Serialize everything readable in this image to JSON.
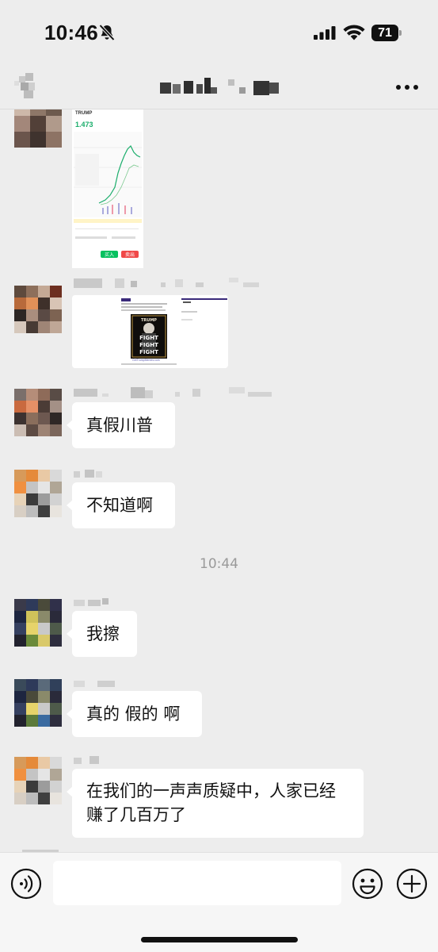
{
  "status_bar": {
    "time": "10:46",
    "battery": "71",
    "icons": [
      "bell-slash-icon",
      "cellular-signal-icon",
      "wifi-icon",
      "battery-icon"
    ]
  },
  "nav": {
    "back_icon": "back-icon",
    "title_icon": "pixelated-chat-title",
    "more_icon": "more-icon"
  },
  "messages": [
    {
      "type": "image",
      "thumb": {
        "token": "TRUMP",
        "price": "1.473",
        "buy": "买入",
        "sell": "卖出"
      }
    },
    {
      "type": "image",
      "thumb": {
        "poster": [
          "TRUMP",
          "FIGHT",
          "FIGHT",
          "FIGHT"
        ],
        "site": "GetTrumpMemes.com"
      }
    },
    {
      "type": "text",
      "text": "真假川普"
    },
    {
      "type": "text",
      "text": "不知道啊"
    },
    {
      "type": "time",
      "text": "10:44"
    },
    {
      "type": "text",
      "text": "我擦"
    },
    {
      "type": "text",
      "text": "真的 假的 啊"
    },
    {
      "type": "text",
      "text": "在我们的一声声质疑中，人家已经赚了几百万了"
    }
  ],
  "input_bar": {
    "placeholder": "",
    "icons": [
      "voice-icon",
      "emoji-icon",
      "plus-icon"
    ]
  },
  "colors": {
    "background": "#ededed",
    "bubble": "#ffffff",
    "buy_green": "#07c160",
    "sell_red": "#f04848",
    "price_green": "#1aad6b"
  }
}
